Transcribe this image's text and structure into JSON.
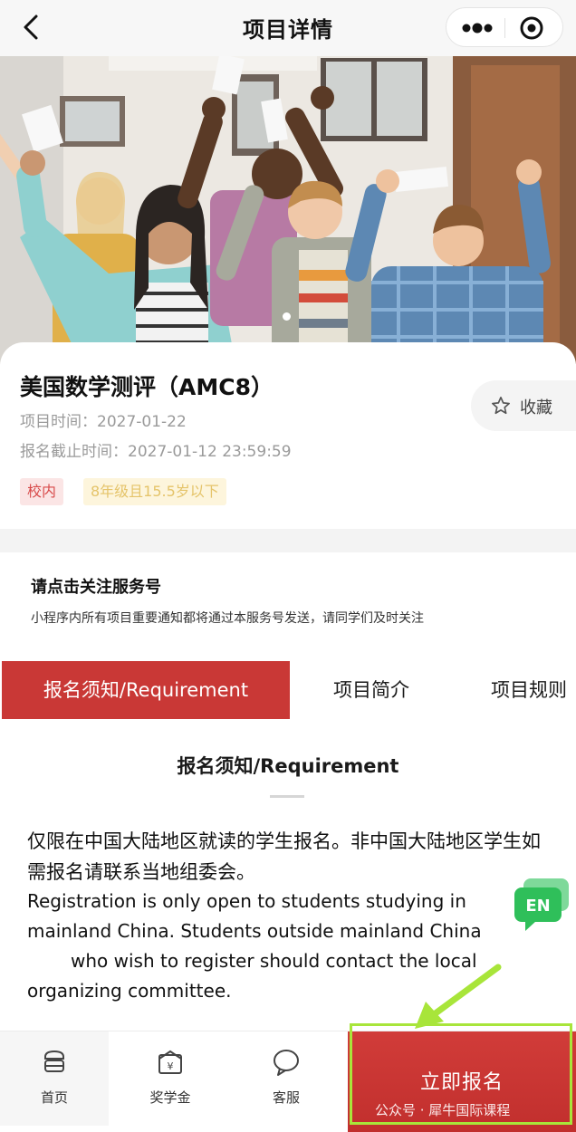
{
  "navbar": {
    "title": "项目详情"
  },
  "program": {
    "title": "美国数学测评（AMC8）",
    "time": "项目时间：2027-01-22",
    "deadline": "报名截止时间：2027-01-12 23:59:59",
    "tags": [
      "校内",
      "8年级且15.5岁以下"
    ],
    "favorite_label": "收藏"
  },
  "follow": {
    "title": "请点击关注服务号",
    "description": "小程序内所有项目重要通知都将通过本服务号发送，请同学们及时关注"
  },
  "tabs": [
    {
      "label": "报名须知/Requirement",
      "active": true
    },
    {
      "label": "项目简介",
      "active": false
    },
    {
      "label": "项目规则",
      "active": false
    }
  ],
  "requirement": {
    "heading": "报名须知/Requirement",
    "cn_text": "仅限在中国大陆地区就读的学生报名。非中国大陆地区学生如需报名请联系当地组委会。",
    "en_lines": [
      "Registration is only open to students studying in",
      "mainland China. Students outside mainland China",
      "who wish to register should contact the local",
      "organizing committee."
    ]
  },
  "en_badge": "EN",
  "bottom_bar": {
    "items": [
      {
        "label": "首页",
        "icon": "home-icon"
      },
      {
        "label": "奖学金",
        "icon": "scholarship-icon"
      },
      {
        "label": "客服",
        "icon": "chat-icon"
      }
    ],
    "enroll_label": "立即报名"
  },
  "watermark": "公众号 · 犀牛国际课程",
  "colors": {
    "accent": "#c93836",
    "highlight": "#a8e53a",
    "badge_green": "#2fbf5a"
  }
}
